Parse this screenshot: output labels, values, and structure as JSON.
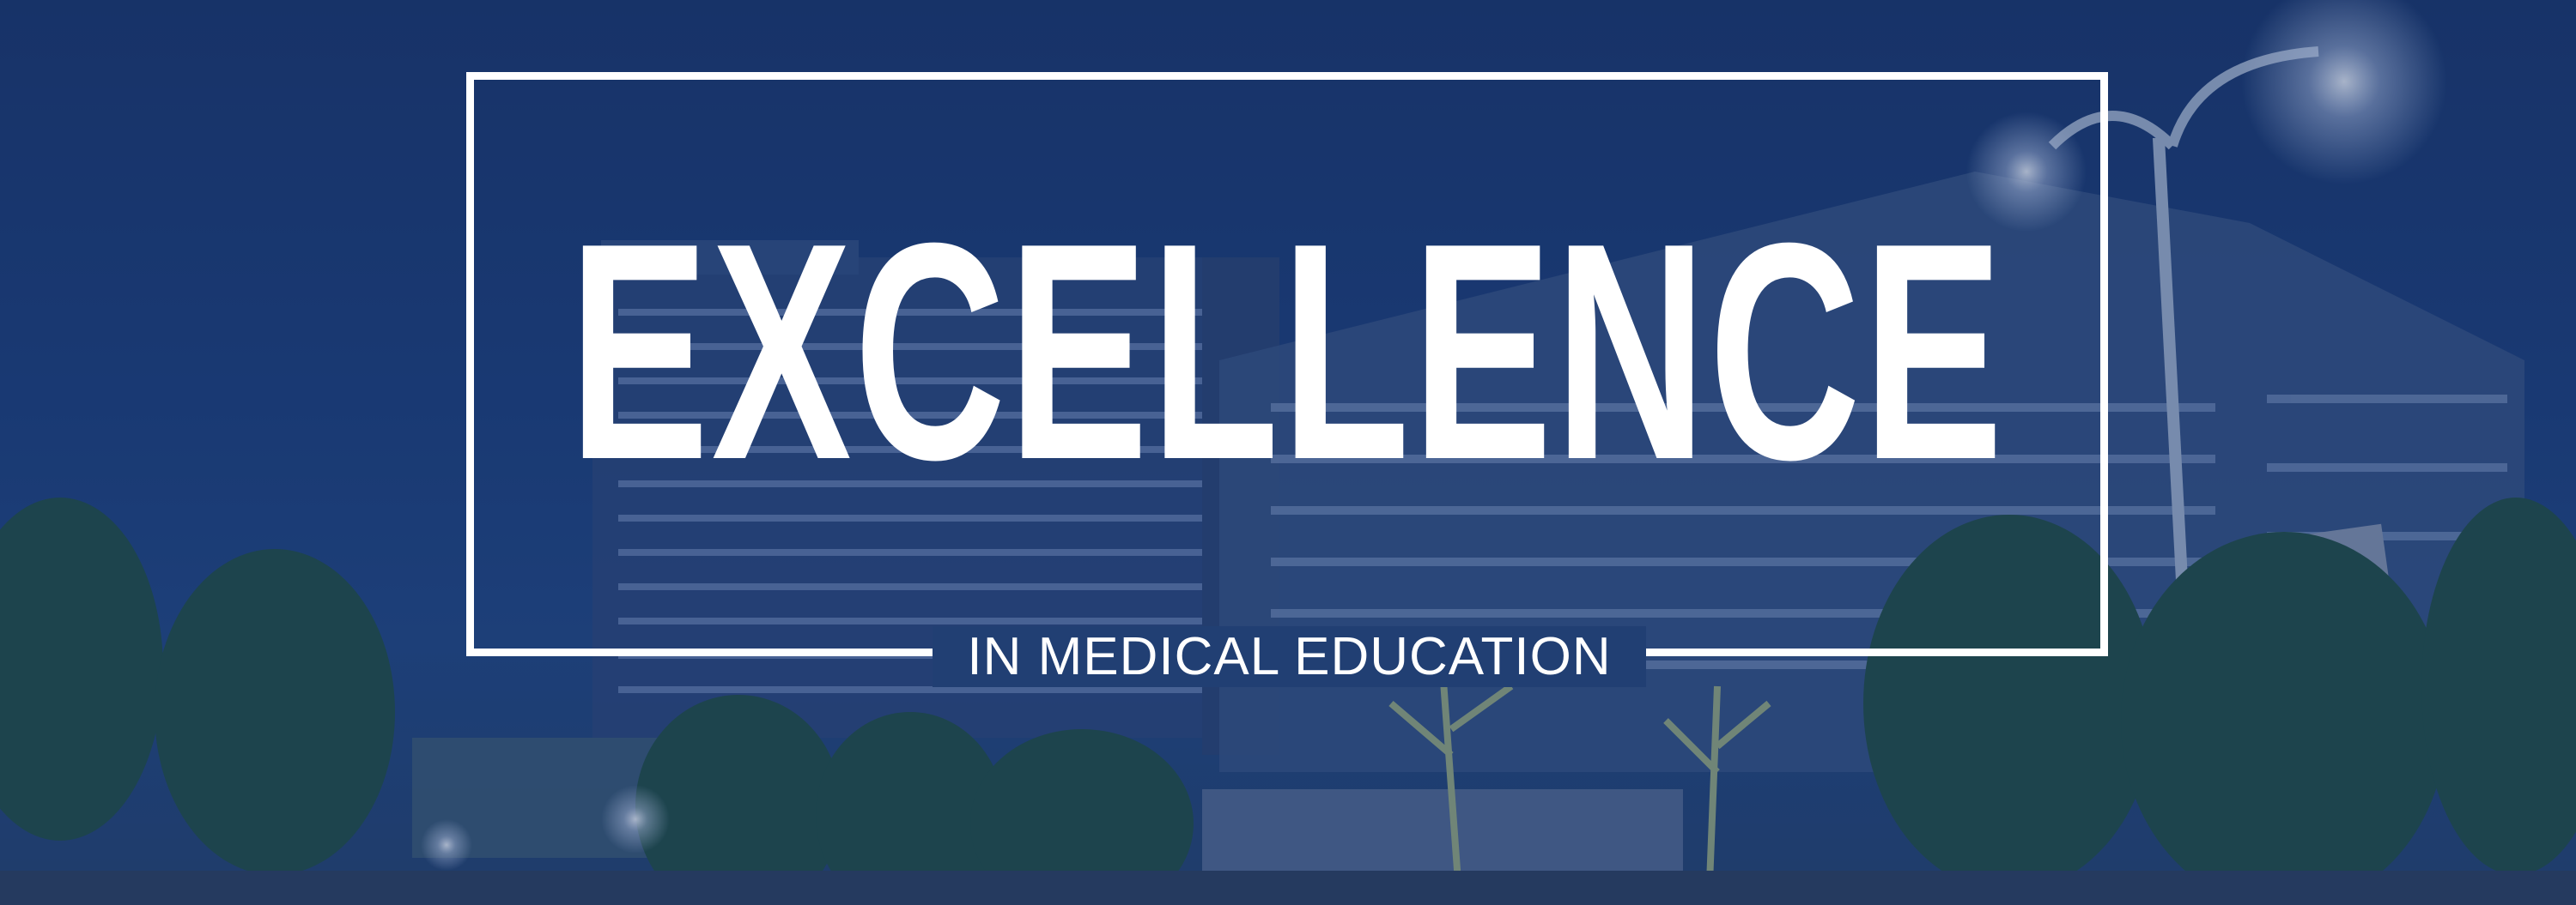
{
  "banner": {
    "headline": "EXCELLENCE",
    "subtitle": "IN MEDICAL EDUCATION"
  },
  "photo": {
    "subject": "hospital-buildings-at-dusk"
  },
  "colors": {
    "overlay": "#1a3a74",
    "text": "#ffffff"
  }
}
